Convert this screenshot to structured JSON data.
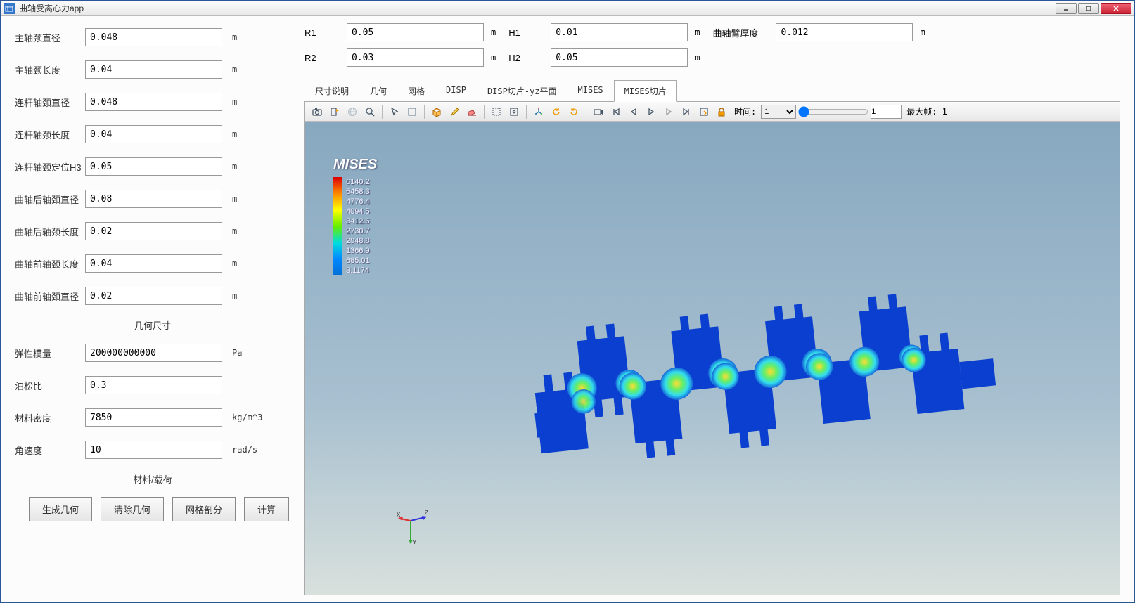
{
  "window": {
    "title": "曲轴受离心力app"
  },
  "left_fields": [
    {
      "label": "主轴颈直径",
      "value": "0.048",
      "unit": "m"
    },
    {
      "label": "主轴颈长度",
      "value": "0.04",
      "unit": "m"
    },
    {
      "label": "连杆轴颈直径",
      "value": "0.048",
      "unit": "m"
    },
    {
      "label": "连杆轴颈长度",
      "value": "0.04",
      "unit": "m"
    },
    {
      "label": "连杆轴颈定位H3",
      "value": "0.05",
      "unit": "m"
    },
    {
      "label": "曲轴后轴颈直径",
      "value": "0.08",
      "unit": "m"
    },
    {
      "label": "曲轴后轴颈长度",
      "value": "0.02",
      "unit": "m"
    },
    {
      "label": "曲轴前轴颈长度",
      "value": "0.04",
      "unit": "m"
    },
    {
      "label": "曲轴前轴颈直径",
      "value": "0.02",
      "unit": "m"
    }
  ],
  "divider1": "几何尺寸",
  "material_fields": [
    {
      "label": "弹性模量",
      "value": "200000000000",
      "unit": "Pa"
    },
    {
      "label": "泊松比",
      "value": "0.3",
      "unit": ""
    },
    {
      "label": "材料密度",
      "value": "7850",
      "unit": "kg/m^3"
    },
    {
      "label": "角速度",
      "value": "10",
      "unit": "rad/s"
    }
  ],
  "divider2": "材料/载荷",
  "actions": [
    "生成几何",
    "清除几何",
    "网格剖分",
    "计算"
  ],
  "top_row1": [
    {
      "label": "R1",
      "value": "0.05",
      "unit": "m"
    },
    {
      "label": "H1",
      "value": "0.01",
      "unit": "m"
    },
    {
      "label": "曲轴臂厚度",
      "value": "0.012",
      "unit": "m",
      "label_w": 90
    }
  ],
  "top_row2": [
    {
      "label": "R2",
      "value": "0.03",
      "unit": "m"
    },
    {
      "label": "H2",
      "value": "0.05",
      "unit": "m"
    }
  ],
  "tabs": [
    "尺寸说明",
    "几何",
    "网格",
    "DISP",
    "DISP切片-yz平面",
    "MISES",
    "MISES切片"
  ],
  "active_tab": 6,
  "toolbar_time_label": "时间:",
  "toolbar_time_value": "1",
  "toolbar_frame_value": "1",
  "toolbar_maxframe": "最大帧: 1",
  "legend": {
    "title": "MISES",
    "values": [
      "6140.2",
      "5458.3",
      "4776.4",
      "4094.5",
      "3412.6",
      "2730.7",
      "2048.8",
      "1366.9",
      "685.01",
      "3.1174"
    ]
  },
  "chart_data": {
    "type": "heatmap",
    "title": "MISES",
    "colorbar_values": [
      6140.2,
      5458.3,
      4776.4,
      4094.5,
      3412.6,
      2730.7,
      2048.8,
      1366.9,
      685.01,
      3.1174
    ],
    "colorbar_range": [
      3.1174,
      6140.2
    ],
    "description": "von Mises stress contour slice of crankshaft under centrifugal load"
  }
}
